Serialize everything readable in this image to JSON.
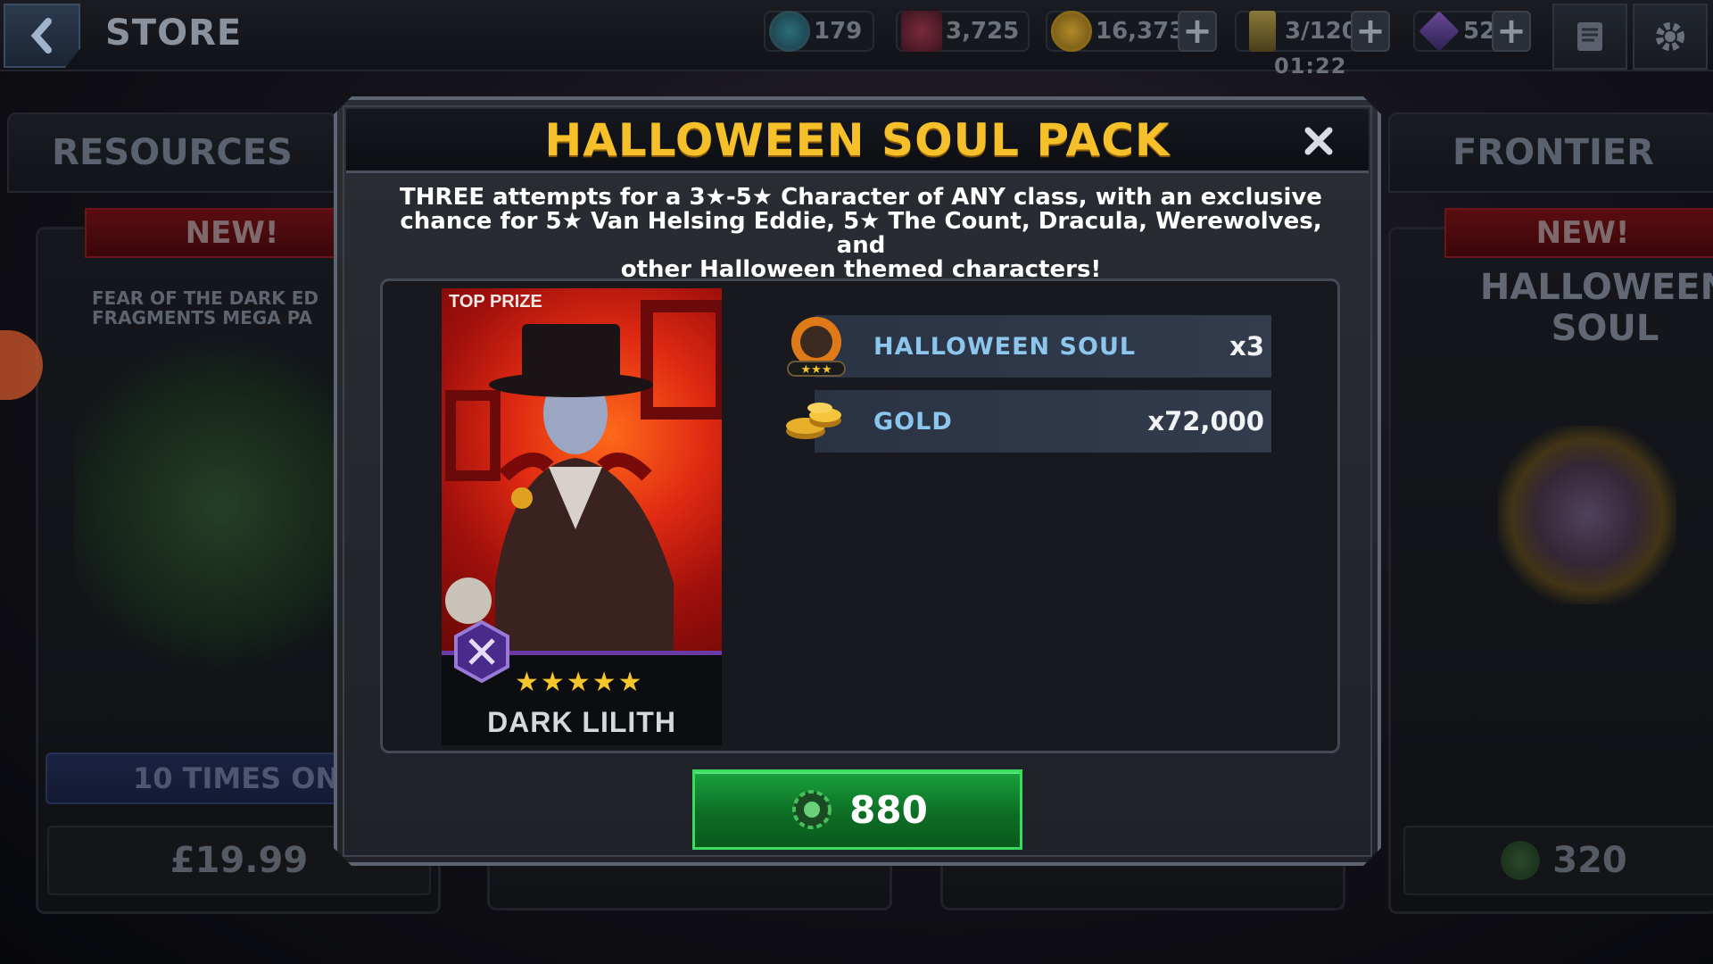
{
  "topbar": {
    "title": "STORE",
    "currencies": [
      {
        "icon": "battlechips-icon",
        "value": "179"
      },
      {
        "icon": "loyalty-icon",
        "value": "3,725"
      },
      {
        "icon": "gold-coin-icon",
        "value": "16,373"
      },
      {
        "icon": "energy-hourglass-icon",
        "value": "3/120"
      },
      {
        "icon": "units-crystal-icon",
        "value": "52"
      }
    ],
    "energy_timer": "01:22"
  },
  "left_tab": {
    "label": "RESOURCES",
    "badge": "NEW!",
    "card_title": "FEAR OF THE DARK ED FRAGMENTS MEGA PA",
    "limit": "10 TIMES ONL",
    "price": "£19.99"
  },
  "right_tab": {
    "label": "FRONTIER",
    "badge": "NEW!",
    "card_title": "HALLOWEEN SOUL",
    "price": "320"
  },
  "modal": {
    "title": "HALLOWEEN SOUL PACK",
    "close_icon": "close-icon",
    "description_line1": "THREE attempts for a 3★-5★ Character of ANY class, with an exclusive",
    "description_line2": "chance for 5★ Van Helsing Eddie, 5★ The Count, Dracula, Werewolves, and",
    "description_line3": "other Halloween themed characters!",
    "top_prize_label": "TOP PRIZE",
    "character_name": "DARK LILITH",
    "character_stars": "★★★★★",
    "rewards": [
      {
        "icon": "halloween-soul-icon",
        "label": "HALLOWEEN SOUL",
        "qty": "x3"
      },
      {
        "icon": "gold-stack-icon",
        "label": "GOLD",
        "qty": "x72,000"
      }
    ],
    "buy_price": "880",
    "colors": {
      "title": "#f5c02a",
      "reward_label": "#8dc6ec",
      "buy": "#0d6e25"
    }
  }
}
